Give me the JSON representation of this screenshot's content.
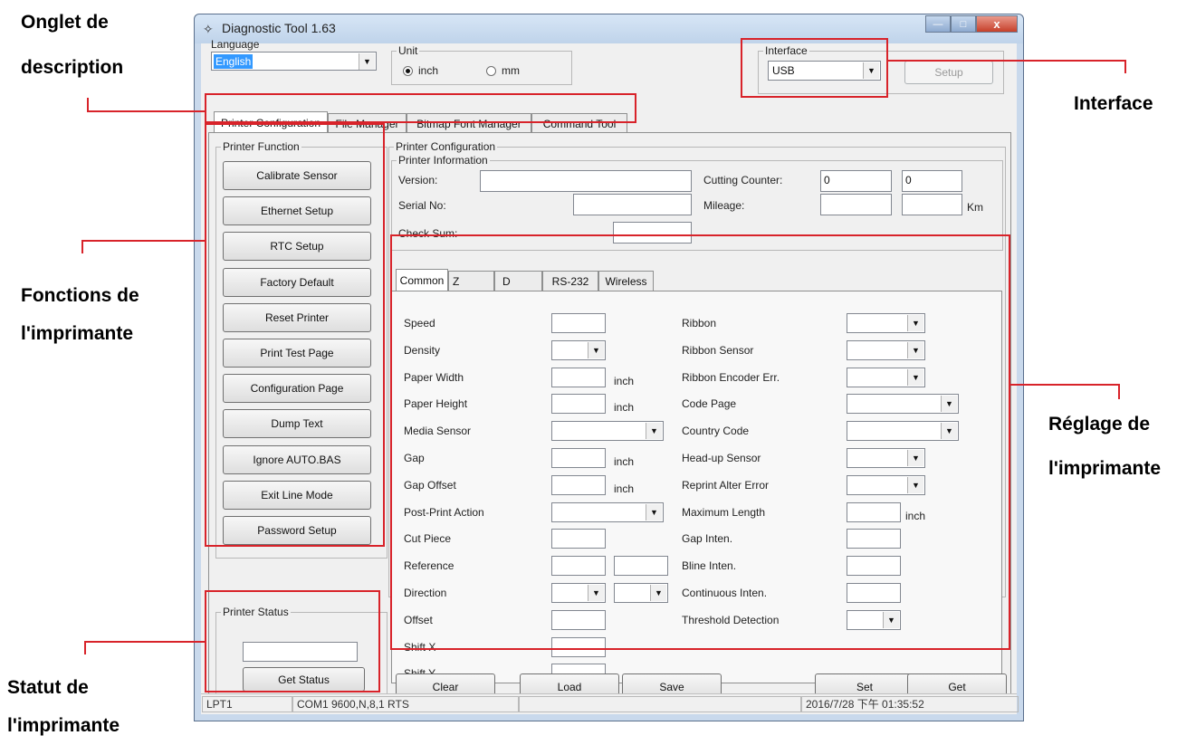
{
  "window": {
    "title": "Diagnostic Tool 1.63",
    "controls": {
      "minimize": "—",
      "maximize": "□",
      "close": "x"
    }
  },
  "language": {
    "label": "Language",
    "value": "English"
  },
  "unit": {
    "label": "Unit",
    "inch": "inch",
    "mm": "mm",
    "selected": "inch"
  },
  "interface": {
    "label": "Interface",
    "value": "USB",
    "setup_label": "Setup"
  },
  "tabs": [
    "Printer Configuration",
    "File Manager",
    "Bitmap Font Manager",
    "Command Tool"
  ],
  "printer_function": {
    "title": "Printer Function",
    "buttons": [
      "Calibrate Sensor",
      "Ethernet Setup",
      "RTC Setup",
      "Factory Default",
      "Reset Printer",
      "Print Test Page",
      "Configuration Page",
      "Dump Text",
      "Ignore AUTO.BAS",
      "Exit Line Mode",
      "Password Setup"
    ]
  },
  "printer_status": {
    "title": "Printer Status",
    "value": "",
    "button": "Get Status"
  },
  "printer_configuration": {
    "title": "Printer Configuration",
    "info_title": "Printer Information",
    "version_label": "Version:",
    "serial_label": "Serial No:",
    "checksum_label": "Check Sum:",
    "cutting_label": "Cutting Counter:",
    "cutting_values": [
      "0",
      "0"
    ],
    "mileage_label": "Mileage:",
    "mileage_unit": "Km"
  },
  "inner_tabs": [
    "Common",
    "Z",
    "D",
    "RS-232",
    "Wireless"
  ],
  "common_left": {
    "speed": "Speed",
    "density": "Density",
    "paper_width": "Paper Width",
    "paper_height": "Paper Height",
    "media_sensor": "Media Sensor",
    "gap": "Gap",
    "gap_offset": "Gap Offset",
    "post_print": "Post-Print Action",
    "cut_piece": "Cut Piece",
    "reference": "Reference",
    "direction": "Direction",
    "offset": "Offset",
    "shift_x": "Shift X",
    "shift_y": "Shift Y",
    "unit": "inch"
  },
  "common_right": {
    "ribbon": "Ribbon",
    "ribbon_sensor": "Ribbon Sensor",
    "ribbon_encoder": "Ribbon Encoder Err.",
    "code_page": "Code Page",
    "country_code": "Country Code",
    "headup_sensor": "Head-up Sensor",
    "reprint": "Reprint Alter Error",
    "max_length": "Maximum Length",
    "gap_inten": "Gap Inten.",
    "bline_inten": "Bline Inten.",
    "continuous_inten": "Continuous Inten.",
    "threshold": "Threshold Detection",
    "unit": "inch"
  },
  "bottom_buttons": {
    "clear": "Clear",
    "load": "Load",
    "save": "Save",
    "set": "Set",
    "get": "Get"
  },
  "statusbar": {
    "port": "LPT1",
    "com": "COM1 9600,N,8,1 RTS",
    "middle": "",
    "datetime": "2016/7/28 下午 01:35:52"
  },
  "annotations": {
    "tab_desc_1": "Onglet de",
    "tab_desc_2": "description",
    "interface": "Interface",
    "functions_1": "Fonctions de",
    "functions_2": "l'imprimante",
    "settings_1": "Réglage de",
    "settings_2": "l'imprimante",
    "status_1": "Statut de",
    "status_2": "l'imprimante"
  },
  "colors": {
    "annotation_red": "#d8232a",
    "window_frame": "#c9d9ec",
    "client_bg": "#f0f0f0"
  }
}
